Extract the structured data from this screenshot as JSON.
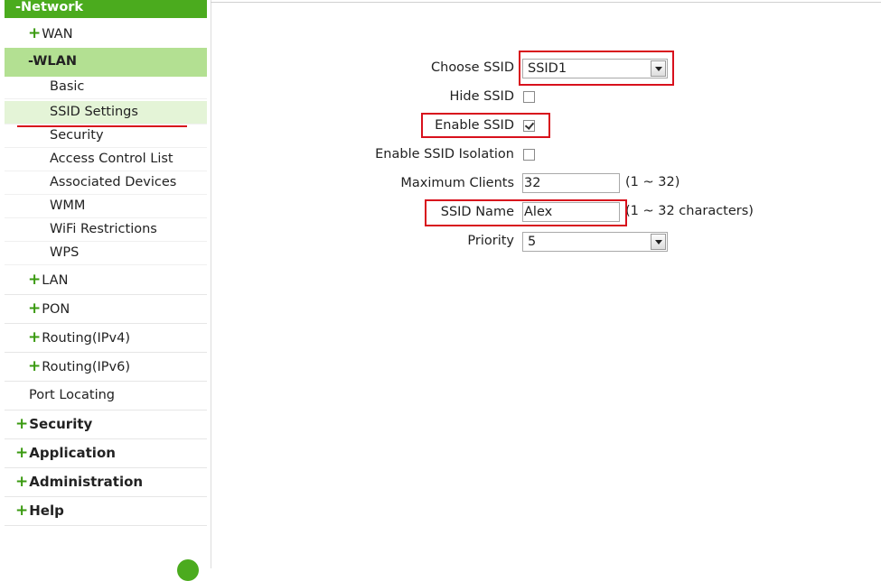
{
  "sidebar": {
    "network": "-Network",
    "wan": "WAN",
    "wlan": "-WLAN",
    "wlan_items": [
      "Basic",
      "SSID Settings",
      "Security",
      "Access Control List",
      "Associated Devices",
      "WMM",
      "WiFi Restrictions",
      "WPS"
    ],
    "lan": "LAN",
    "pon": "PON",
    "routing_ipv4": "Routing(IPv4)",
    "routing_ipv6": "Routing(IPv6)",
    "port_locating": "Port Locating",
    "security": "Security",
    "application": "Application",
    "administration": "Administration",
    "help": "Help",
    "plus": "+"
  },
  "form": {
    "choose_ssid_label": "Choose SSID",
    "choose_ssid_value": "SSID1",
    "hide_ssid_label": "Hide SSID",
    "hide_ssid_checked": false,
    "enable_ssid_label": "Enable SSID",
    "enable_ssid_checked": true,
    "isolation_label": "Enable SSID Isolation",
    "isolation_checked": false,
    "max_clients_label": "Maximum Clients",
    "max_clients_value": "32",
    "max_clients_hint": "(1 ~ 32)",
    "ssid_name_label": "SSID Name",
    "ssid_name_value": "Alex",
    "ssid_name_hint": "(1 ~ 32 characters)",
    "priority_label": "Priority",
    "priority_value": "5"
  },
  "colors": {
    "brand_green": "#4bab1e",
    "active_row": "#b3e092",
    "highlight_red": "#d8101c"
  }
}
